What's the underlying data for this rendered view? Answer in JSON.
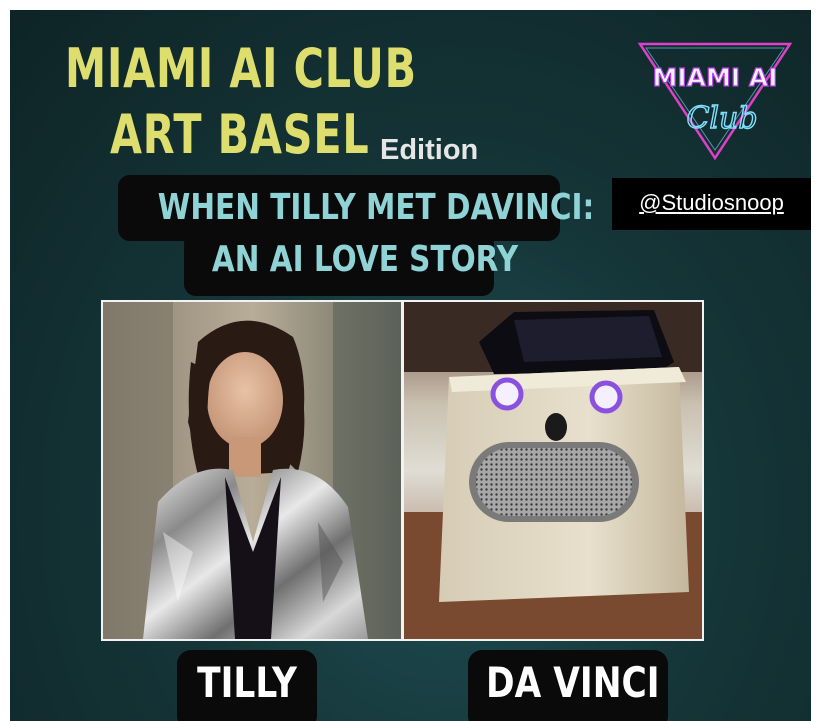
{
  "poster": {
    "title_line1": "MIAMI AI CLUB",
    "title_line2": "ART BASEL",
    "edition": "Edition",
    "headline_line1": "WHEN TILLY MET DAVINCI:",
    "headline_line2": "AN AI LOVE STORY",
    "handle": "@Studiosnoop",
    "logo": {
      "word1": "MIAMI AI",
      "word2": "Club",
      "icon": "neon-triangle-icon"
    },
    "left_name": "TILLY",
    "right_name": "DA VINCI"
  },
  "colors": {
    "background": "#153538",
    "title": "#dede6e",
    "headline": "#8fd3d6",
    "label_bg": "#0a0a0a",
    "logo_pink": "#e040c8",
    "logo_cyan": "#7fe0ff"
  }
}
